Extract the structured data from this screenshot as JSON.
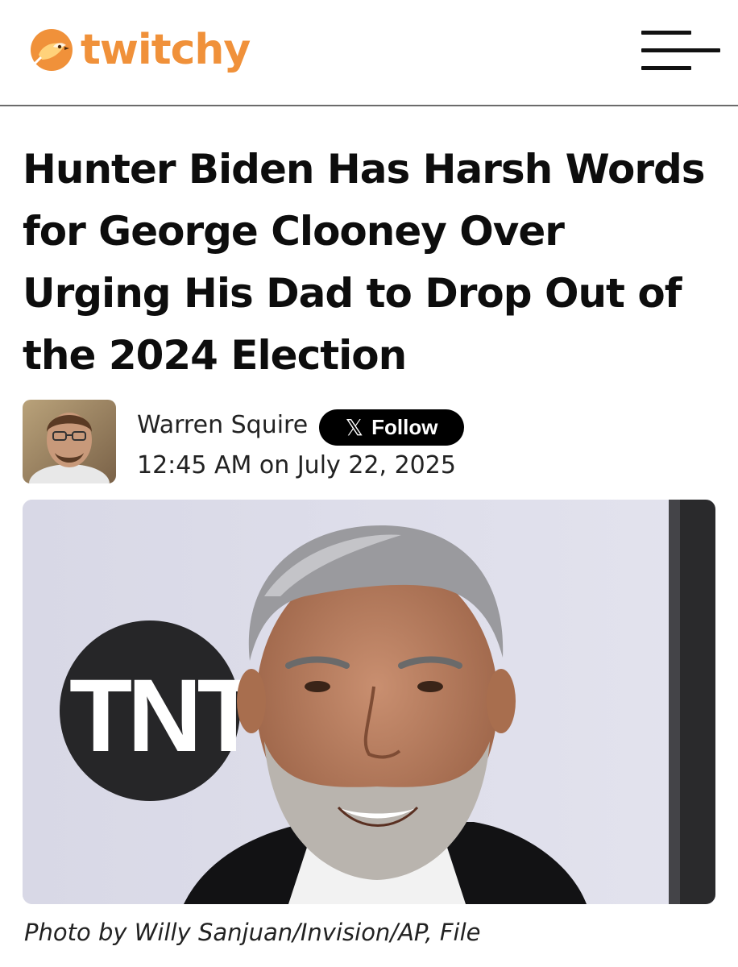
{
  "header": {
    "logo_text": "twitchy",
    "logo_color": "#f0913a",
    "menu_icon": "hamburger-icon"
  },
  "article": {
    "headline": "Hunter Biden Has Harsh Words for George Clooney Over Urging His Dad to Drop Out of the 2024 Election",
    "author": "Warren Squire",
    "follow_label": "Follow",
    "follow_icon": "x-logo-icon",
    "timestamp": "12:45 AM on July 22, 2025",
    "photo_logo_text": "TNT",
    "photo_caption": "Photo by Willy Sanjuan/Invision/AP, File"
  }
}
